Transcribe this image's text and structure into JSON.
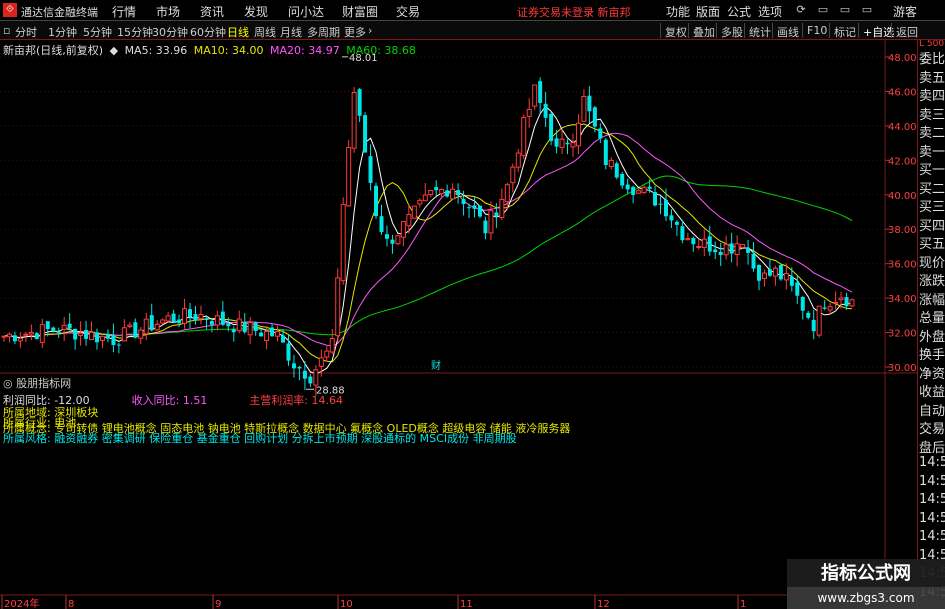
{
  "app": {
    "title": "通达信金融终端",
    "menu": [
      "行情",
      "市场",
      "资讯",
      "发现",
      "问小达",
      "财富圈",
      "交易"
    ],
    "alert": "证券交易未登录  新亩邦",
    "right_menu": [
      "功能",
      "版面",
      "公式",
      "选项"
    ],
    "guest": "游客"
  },
  "toolbar": {
    "periods": [
      "分时",
      "1分钟",
      "5分钟",
      "15分钟",
      "30分钟",
      "60分钟",
      "日线",
      "周线",
      "月线",
      "多周期",
      "更多"
    ],
    "active_period": "日线",
    "buttons": [
      "复权",
      "叠加",
      "多股",
      "统计",
      "画线",
      "F10",
      "标记",
      "+自选",
      "返回"
    ]
  },
  "stock": {
    "name": "新亩邦(日线,前复权)",
    "ma5": "MA5: 33.96",
    "ma10": "MA10: 34.00",
    "ma20": "MA20: 34.97",
    "ma60": "MA60: 38.68"
  },
  "colors": {
    "up": "#ff3b3b",
    "down": "#00e6e6",
    "ma5": "#ffffff",
    "ma10": "#e6e600",
    "ma20": "#ff55ff",
    "ma60": "#00d400"
  },
  "chart_data": {
    "type": "candlestick",
    "y_ticks": [
      "48.00",
      "46.00",
      "44.00",
      "42.00",
      "40.00",
      "38.00",
      "36.00",
      "34.00",
      "32.00",
      "30.00"
    ],
    "ylim": [
      29.2,
      49.0
    ],
    "high_annotation": "48.01",
    "low_annotation": "28.88",
    "finance_marker": "财",
    "x_labels": [
      "2024年",
      "8",
      "9",
      "10",
      "11",
      "12",
      "1"
    ]
  },
  "indicator": {
    "title": "股朋指标网",
    "line1": {
      "a": "利润同比: -12.00",
      "b": "收入同比: 1.51",
      "c": "主营利润率: 14.64"
    },
    "line2": "所属地域: 深圳板块",
    "line3": "所属行业: 电池",
    "line4": "所属概念: 专司转债 锂电池概念 固态电池 钠电池 特斯拉概念 数据中心 氟概念 OLED概念 超级电容 储能 液冷服务器",
    "line5": "所属风格: 融资融券 密集调研 保险重仓 基金重仓 回购计划 分拆上市预期 深股通标的 MSCI成份 非周期股"
  },
  "right_panel": {
    "scale": "L 500",
    "items": [
      "委比",
      "卖五",
      "卖四",
      "卖三",
      "卖二",
      "卖一",
      "买一",
      "买二",
      "买三",
      "买四",
      "买五",
      "现价",
      "涨跌",
      "涨幅",
      "总量",
      "外盘",
      "换手",
      "净资",
      "收益",
      "自动",
      "交易",
      "盘后",
      "14:5",
      "14:5",
      "14:5",
      "14:5",
      "14:5",
      "14:5",
      "14:5",
      "14:5"
    ]
  },
  "watermark": {
    "brand": "指标公式网",
    "url": "www.zbgs3.com"
  }
}
